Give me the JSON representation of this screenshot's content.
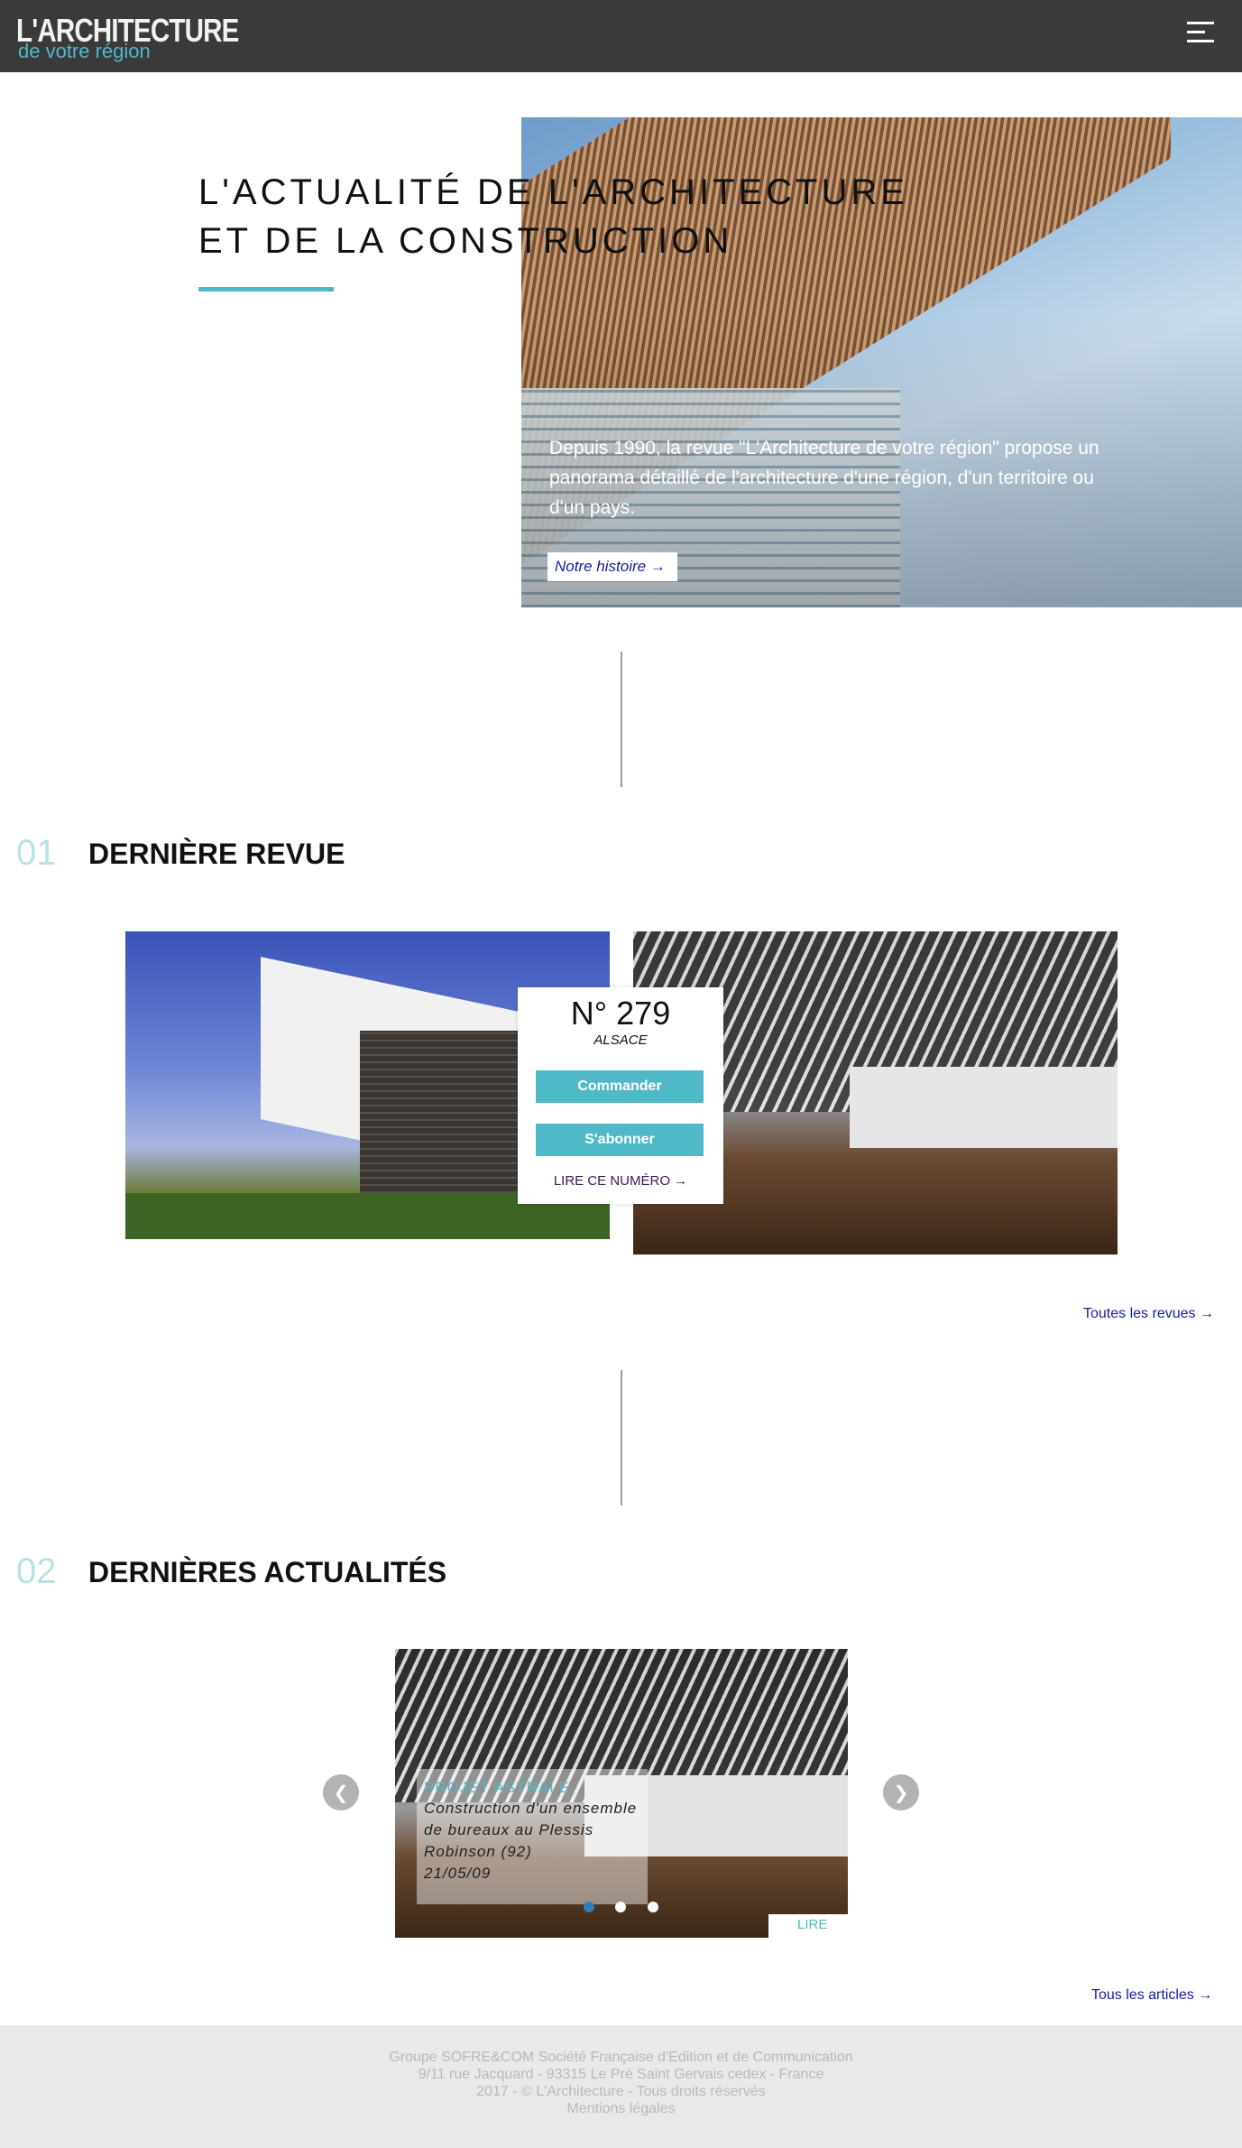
{
  "header": {
    "logo_main": "L'ARCHITECTURE",
    "logo_sub": "de votre région",
    "menu_icon": "hamburger-icon"
  },
  "hero": {
    "title_line1": "L'ACTUALITÉ DE L'ARCHITECTURE",
    "title_line2": "ET DE LA CONSTRUCTION",
    "text": "Depuis 1990, la revue \"L'Architecture de votre région\" propose un panorama détaillé de l'architecture d'une région, d'un territoire ou d'un pays.",
    "button_label": "Notre histoire →"
  },
  "section1": {
    "number": "01",
    "title": "DERNIÈRE REVUE",
    "issue_number": "N° 279",
    "issue_region": "ALSACE",
    "order_label": "Commander",
    "subscribe_label": "S'abonner",
    "read_label": "LIRE CE NUMÉRO →",
    "all_link": "Toutes les revues →"
  },
  "section2": {
    "number": "02",
    "title": "DERNIÈRES ACTUALITÉS",
    "news_title": "PROJET ASTRALE",
    "news_desc": "Construction d'un ensemble de bureaux au Plessis Robinson (92)",
    "news_date": "21/05/09",
    "read_label": "LIRE",
    "prev_label": "❮",
    "next_label": "❯",
    "active_dot": 0,
    "dot_count": 3,
    "all_link": "Tous les articles →"
  },
  "footer": {
    "line1": "Groupe SOFRE&COM Société Française d'Edition et de Communication",
    "line2": "9/11 rue Jacquard - 93315 Le Pré Saint Gervais cedex - France",
    "line3": "2017 - © L'Architecture - Tous droits réservés",
    "line4": "Mentions légales"
  },
  "colors": {
    "accent": "#4fb9c7",
    "header_bg": "#3a3a3a",
    "link": "#1a1aa6",
    "footer_bg": "#e9e9ea"
  }
}
